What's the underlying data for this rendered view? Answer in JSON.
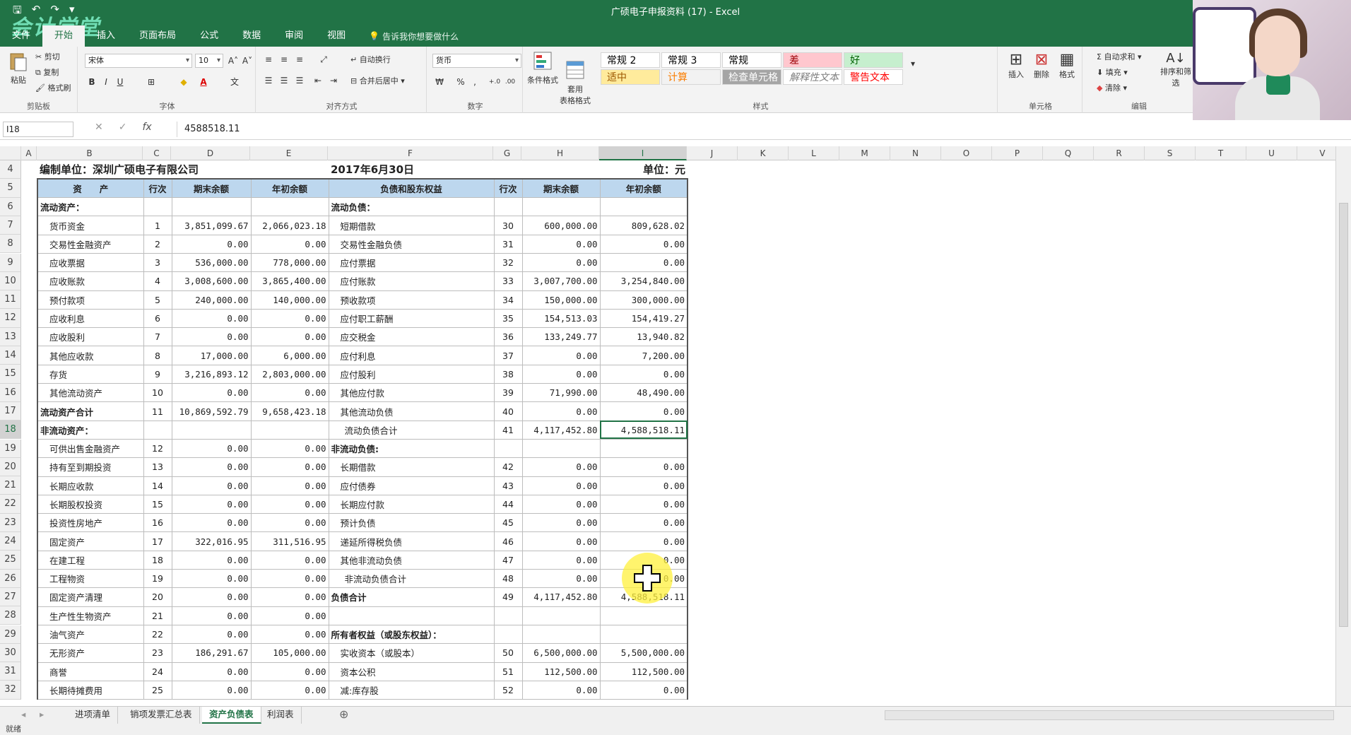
{
  "window": {
    "title": "广硕电子申报资料 (17) - Excel"
  },
  "logo_text": "会计学堂",
  "menu": [
    "文件",
    "开始",
    "插入",
    "页面布局",
    "公式",
    "数据",
    "审阅",
    "视图"
  ],
  "menu_active_index": 1,
  "tellme": "告诉我你想要做什么",
  "ribbon": {
    "clipboard": {
      "paste": "粘贴",
      "cut": "剪切",
      "copy": "复制",
      "format_painter": "格式刷",
      "label": "剪贴板"
    },
    "font": {
      "name": "宋体",
      "size": "10",
      "bold": "B",
      "italic": "I",
      "underline": "U",
      "label": "字体"
    },
    "align": {
      "wrap": "自动换行",
      "merge": "合并后居中",
      "label": "对齐方式"
    },
    "number": {
      "format": "货币",
      "percent": "%",
      "comma": ",",
      "label": "数字"
    },
    "styles_group": {
      "conditional": "条件格式",
      "table": "套用\n表格格式",
      "label": "样式"
    },
    "styles": [
      {
        "name": "常规 2",
        "bg": "#ffffff",
        "color": "#000000"
      },
      {
        "name": "常规 3",
        "bg": "#ffffff",
        "color": "#000000"
      },
      {
        "name": "常规",
        "bg": "#ffffff",
        "color": "#000000"
      },
      {
        "name": "差",
        "bg": "#ffc7ce",
        "color": "#9c0006"
      },
      {
        "name": "好",
        "bg": "#c6efce",
        "color": "#006100"
      },
      {
        "name": "适中",
        "bg": "#ffeb9c",
        "color": "#9c5700"
      },
      {
        "name": "计算",
        "bg": "#f2f2f2",
        "color": "#fa7d00"
      },
      {
        "name": "检查单元格",
        "bg": "#a5a5a5",
        "color": "#ffffff"
      },
      {
        "name": "解释性文本",
        "bg": "#ffffff",
        "color": "#7f7f7f"
      },
      {
        "name": "警告文本",
        "bg": "#ffffff",
        "color": "#ff0000"
      }
    ],
    "cells": {
      "insert": "插入",
      "delete": "删除",
      "format": "格式",
      "label": "单元格"
    },
    "editing": {
      "autosum": "自动求和",
      "fill": "填充",
      "clear": "清除",
      "sort": "排序和筛选",
      "label": "编辑"
    }
  },
  "formula_bar": {
    "name_box": "I18",
    "value": "4588518.11"
  },
  "columns": [
    {
      "l": "A",
      "w": 22
    },
    {
      "l": "B",
      "w": 150
    },
    {
      "l": "C",
      "w": 40
    },
    {
      "l": "D",
      "w": 112
    },
    {
      "l": "E",
      "w": 110
    },
    {
      "l": "F",
      "w": 234
    },
    {
      "l": "G",
      "w": 40
    },
    {
      "l": "H",
      "w": 110
    },
    {
      "l": "I",
      "w": 124
    },
    {
      "l": "J",
      "w": 72
    },
    {
      "l": "K",
      "w": 72
    },
    {
      "l": "L",
      "w": 72
    },
    {
      "l": "M",
      "w": 72
    },
    {
      "l": "N",
      "w": 72
    },
    {
      "l": "O",
      "w": 72
    },
    {
      "l": "P",
      "w": 72
    },
    {
      "l": "Q",
      "w": 72
    },
    {
      "l": "R",
      "w": 72
    },
    {
      "l": "S",
      "w": 72
    },
    {
      "l": "T",
      "w": 72
    },
    {
      "l": "U",
      "w": 72
    },
    {
      "l": "V",
      "w": 72
    }
  ],
  "selected_col": "I",
  "selected_row": "18",
  "row_numbers": [
    "4",
    "5",
    "6",
    "7",
    "8",
    "9",
    "10",
    "11",
    "12",
    "13",
    "14",
    "15",
    "16",
    "17",
    "18",
    "19",
    "20",
    "21",
    "22",
    "23",
    "24",
    "25",
    "26",
    "27",
    "28",
    "29",
    "30",
    "31",
    "32"
  ],
  "sheet": {
    "company": "编制单位：深圳广硕电子有限公司",
    "date": "2017年6月30日",
    "unit": "单位：元",
    "headers": [
      "资　　产",
      "行次",
      "期末余额",
      "年初余额",
      "负债和股东权益",
      "行次",
      "期末余额",
      "年初余额"
    ],
    "rows": [
      [
        "流动资产：",
        "",
        "",
        "",
        "流动负债：",
        "",
        "",
        ""
      ],
      [
        "货币资金",
        "1",
        "3,851,099.67",
        "2,066,023.18",
        "短期借款",
        "30",
        "600,000.00",
        "809,628.02"
      ],
      [
        "交易性金融资产",
        "2",
        "0.00",
        "0.00",
        "交易性金融负债",
        "31",
        "0.00",
        "0.00"
      ],
      [
        "应收票据",
        "3",
        "536,000.00",
        "778,000.00",
        "应付票据",
        "32",
        "0.00",
        "0.00"
      ],
      [
        "应收账款",
        "4",
        "3,008,600.00",
        "3,865,400.00",
        "应付账款",
        "33",
        "3,007,700.00",
        "3,254,840.00"
      ],
      [
        "预付款项",
        "5",
        "240,000.00",
        "140,000.00",
        "预收款项",
        "34",
        "150,000.00",
        "300,000.00"
      ],
      [
        "应收利息",
        "6",
        "0.00",
        "0.00",
        "应付职工薪酬",
        "35",
        "154,513.03",
        "154,419.27"
      ],
      [
        "应收股利",
        "7",
        "0.00",
        "0.00",
        "应交税金",
        "36",
        "133,249.77",
        "13,940.82"
      ],
      [
        "其他应收款",
        "8",
        "17,000.00",
        "6,000.00",
        "应付利息",
        "37",
        "0.00",
        "7,200.00"
      ],
      [
        "存货",
        "9",
        "3,216,893.12",
        "2,803,000.00",
        "应付股利",
        "38",
        "0.00",
        "0.00"
      ],
      [
        "其他流动资产",
        "10",
        "0.00",
        "0.00",
        "其他应付款",
        "39",
        "71,990.00",
        "48,490.00"
      ],
      [
        "流动资产合计",
        "11",
        "10,869,592.79",
        "9,658,423.18",
        "其他流动负债",
        "40",
        "0.00",
        "0.00"
      ],
      [
        "非流动资产：",
        "",
        "",
        "",
        "流动负债合计",
        "41",
        "4,117,452.80",
        "4,588,518.11"
      ],
      [
        "可供出售金融资产",
        "12",
        "0.00",
        "0.00",
        "非流动负债:",
        "",
        "",
        ""
      ],
      [
        "持有至到期投资",
        "13",
        "0.00",
        "0.00",
        "长期借款",
        "42",
        "0.00",
        "0.00"
      ],
      [
        "长期应收款",
        "14",
        "0.00",
        "0.00",
        "应付债券",
        "43",
        "0.00",
        "0.00"
      ],
      [
        "长期股权投资",
        "15",
        "0.00",
        "0.00",
        "长期应付款",
        "44",
        "0.00",
        "0.00"
      ],
      [
        "投资性房地产",
        "16",
        "0.00",
        "0.00",
        "预计负债",
        "45",
        "0.00",
        "0.00"
      ],
      [
        "固定资产",
        "17",
        "322,016.95",
        "311,516.95",
        "递延所得税负债",
        "46",
        "0.00",
        "0.00"
      ],
      [
        "在建工程",
        "18",
        "0.00",
        "0.00",
        "其他非流动负债",
        "47",
        "0.00",
        "0.00"
      ],
      [
        "工程物资",
        "19",
        "0.00",
        "0.00",
        "非流动负债合计",
        "48",
        "0.00",
        "0.00"
      ],
      [
        "固定资产清理",
        "20",
        "0.00",
        "0.00",
        "负债合计",
        "49",
        "4,117,452.80",
        "4,588,518.11"
      ],
      [
        "生产性生物资产",
        "21",
        "0.00",
        "0.00",
        "",
        "",
        "",
        ""
      ],
      [
        "油气资产",
        "22",
        "0.00",
        "0.00",
        "所有者权益（或股东权益）：",
        "",
        "",
        ""
      ],
      [
        "无形资产",
        "23",
        "186,291.67",
        "105,000.00",
        "实收资本（或股本）",
        "50",
        "6,500,000.00",
        "5,500,000.00"
      ],
      [
        "商誉",
        "24",
        "0.00",
        "0.00",
        "资本公积",
        "51",
        "112,500.00",
        "112,500.00"
      ],
      [
        "长期待摊费用",
        "25",
        "0.00",
        "0.00",
        "减:库存股",
        "52",
        "0.00",
        "0.00"
      ]
    ]
  },
  "tabs": [
    "进项清单",
    "销项发票汇总表",
    "资产负债表",
    "利润表"
  ],
  "active_tab": 2,
  "status": "就绪"
}
